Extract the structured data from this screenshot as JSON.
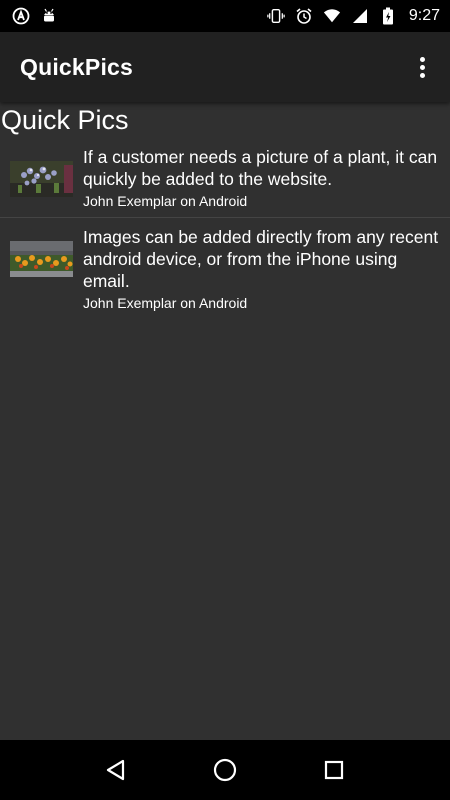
{
  "status_bar": {
    "time": "9:27",
    "left_icons": [
      "app-a-icon",
      "android-debug-icon"
    ],
    "right_icons": [
      "vibrate-icon",
      "alarm-icon",
      "wifi-icon",
      "signal-icon",
      "battery-icon"
    ]
  },
  "app_bar": {
    "title": "QuickPics",
    "menu_icon": "overflow-menu-icon"
  },
  "main": {
    "heading": "Quick Pics",
    "items": [
      {
        "title": "If a customer needs a picture of a plant, it can quickly be added to the website.",
        "subtitle": "John Exemplar on Android",
        "thumbnail": "plant-photo-thumbnail"
      },
      {
        "title": "Images can be added directly from any recent android device, or from the iPhone using email.",
        "subtitle": "John Exemplar on Android",
        "thumbnail": "flowerbed-photo-thumbnail"
      }
    ]
  },
  "nav_bar": {
    "buttons": [
      "back-icon",
      "home-icon",
      "recents-icon"
    ]
  },
  "colors": {
    "background": "#303030",
    "app_bar": "#212121",
    "system_bars": "#000000",
    "text": "#ffffff"
  }
}
